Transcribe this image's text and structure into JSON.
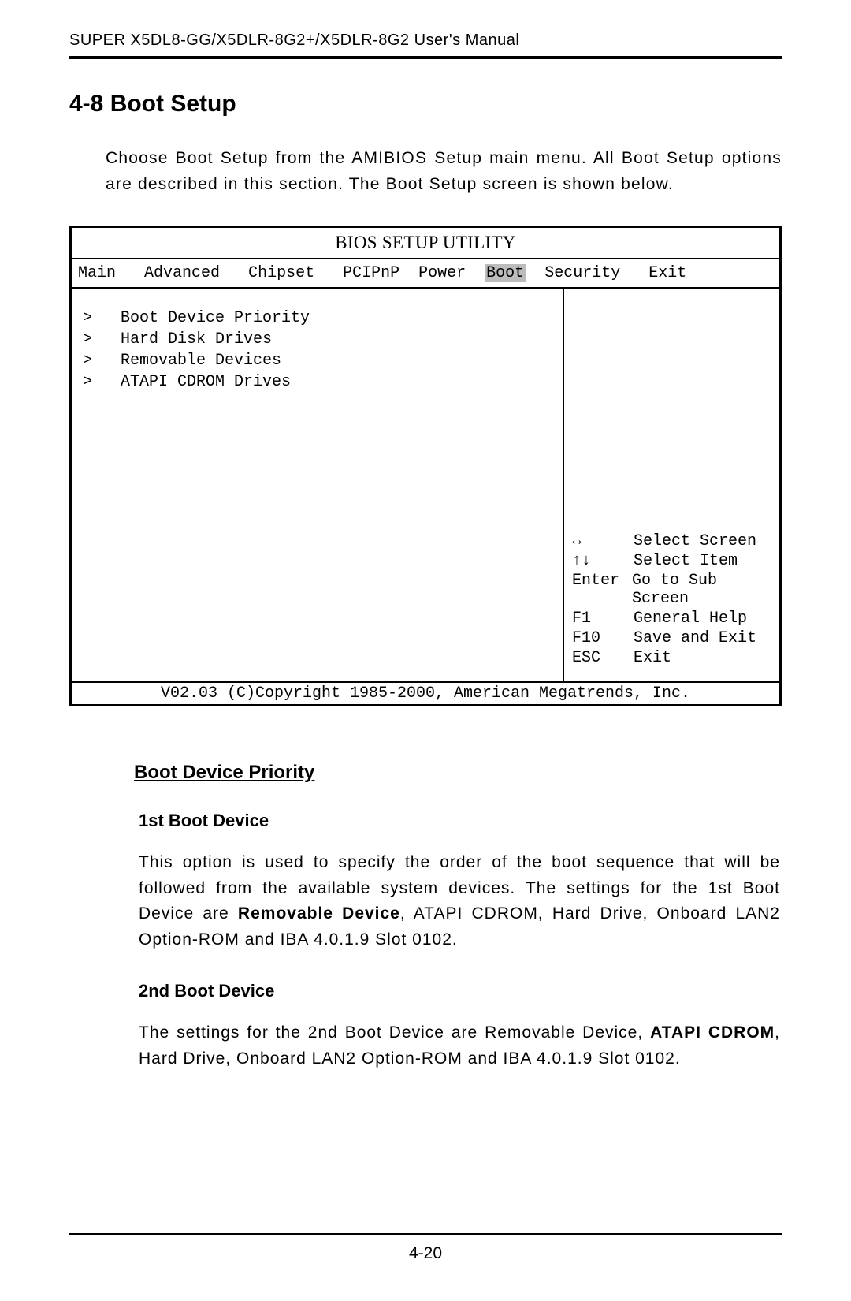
{
  "header": "SUPER X5DL8-GG/X5DLR-8G2+/X5DLR-8G2 User's Manual",
  "section_heading": "4-8   Boot Setup",
  "intro_paragraph": "Choose Boot Setup from the AMIBIOS Setup main menu.  All Boot Setup options are described in this section.  The Boot Setup screen is shown below.",
  "bios": {
    "title": "BIOS SETUP UTILITY",
    "menu": {
      "items": [
        "Main",
        "Advanced",
        "Chipset",
        "PCIPnP",
        "Power",
        "Boot",
        "Security",
        "Exit"
      ],
      "active": "Boot"
    },
    "submenu_marker": ">",
    "submenus": [
      "Boot Device Priority",
      "Hard Disk Drives",
      "Removable Devices",
      "ATAPI CDROM Drives"
    ],
    "help": [
      {
        "key": "↔",
        "desc": "Select Screen"
      },
      {
        "key": "↑↓",
        "desc": "Select Item"
      },
      {
        "key": "Enter",
        "desc": "Go to Sub Screen"
      },
      {
        "key": "F1",
        "desc": "General Help"
      },
      {
        "key": "F10",
        "desc": "Save and Exit"
      },
      {
        "key": "ESC",
        "desc": "Exit"
      }
    ],
    "footer": "V02.03 (C)Copyright 1985-2000, American Megatrends, Inc."
  },
  "subsection_heading": "Boot Device Priority",
  "item1": {
    "heading": "1st Boot Device",
    "text_before_bold": "This option is used to specify the order of the boot sequence that will be followed from the available system devices.  The settings for the 1st Boot Device are ",
    "bold": "Removable Device",
    "text_after_bold": ", ATAPI CDROM, Hard Drive, Onboard LAN2 Option-ROM and IBA 4.0.1.9 Slot 0102."
  },
  "item2": {
    "heading": "2nd Boot Device",
    "text_before_bold": "The settings for the 2nd Boot Device are Removable Device, ",
    "bold": "ATAPI CDROM",
    "text_after_bold": ", Hard Drive, Onboard LAN2 Option-ROM and IBA 4.0.1.9 Slot 0102."
  },
  "page_number": "4-20"
}
